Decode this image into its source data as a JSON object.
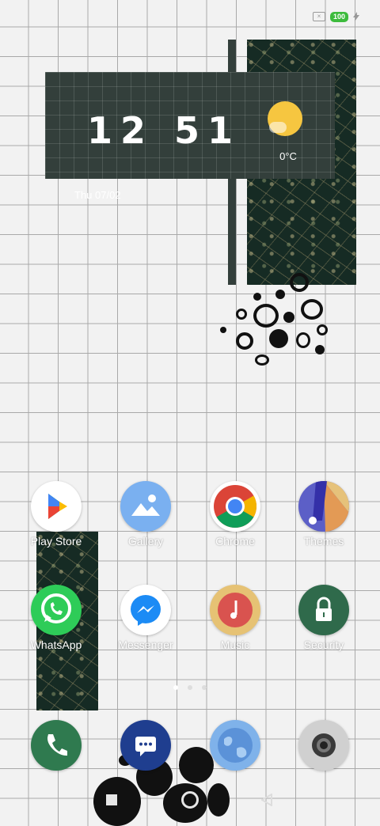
{
  "status_bar": {
    "battery": "100"
  },
  "clock_widget": {
    "time": "12 51",
    "temperature": "0°C",
    "date": "Thu 07/02"
  },
  "apps_row1": [
    {
      "label": "Play Store"
    },
    {
      "label": "Gallery"
    },
    {
      "label": "Chrome"
    },
    {
      "label": "Themes"
    }
  ],
  "apps_row2": [
    {
      "label": "WhatsApp"
    },
    {
      "label": "Messenger"
    },
    {
      "label": "Music"
    },
    {
      "label": "Security"
    }
  ],
  "page_indicator": {
    "count": 3,
    "active": 0
  },
  "dock": [
    {
      "icon": "phone-icon"
    },
    {
      "icon": "messaging-icon"
    },
    {
      "icon": "browser-icon"
    },
    {
      "icon": "camera-icon"
    }
  ],
  "nav_bar": {
    "buttons": [
      "recents",
      "home",
      "back"
    ]
  }
}
